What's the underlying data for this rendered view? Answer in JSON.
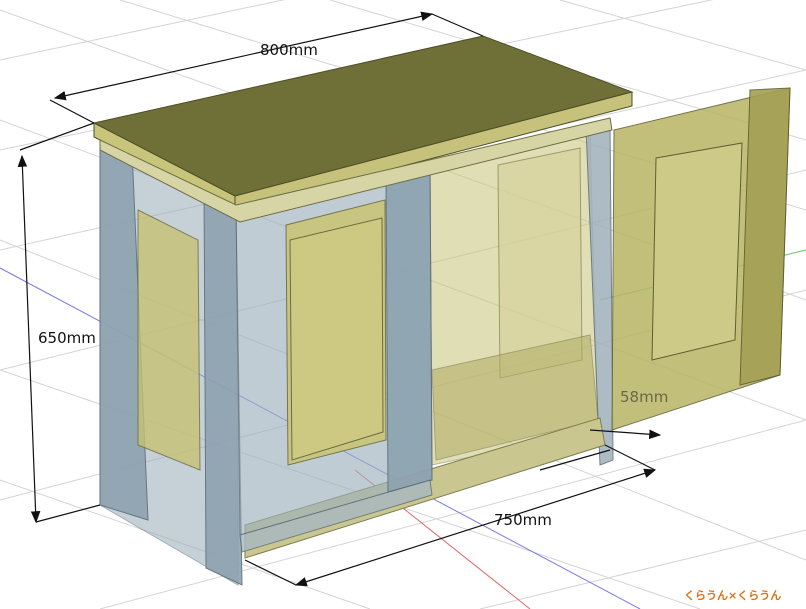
{
  "dimensions": {
    "width": "800mm",
    "height": "650mm",
    "depth": "750mm",
    "hidden": "58mm"
  },
  "watermark": "くらうん×くらうん",
  "colors": {
    "background": "#ffffff",
    "grid": "#cfcfcf",
    "axis_red": "#e05a5a",
    "axis_blue": "#5a5ae0",
    "axis_green": "#4caf50",
    "frame": "#8fa3b0",
    "panel": "#c2bd67",
    "top": "#707039",
    "dimension_line": "#111111"
  },
  "icons": [
    "arrowhead"
  ]
}
